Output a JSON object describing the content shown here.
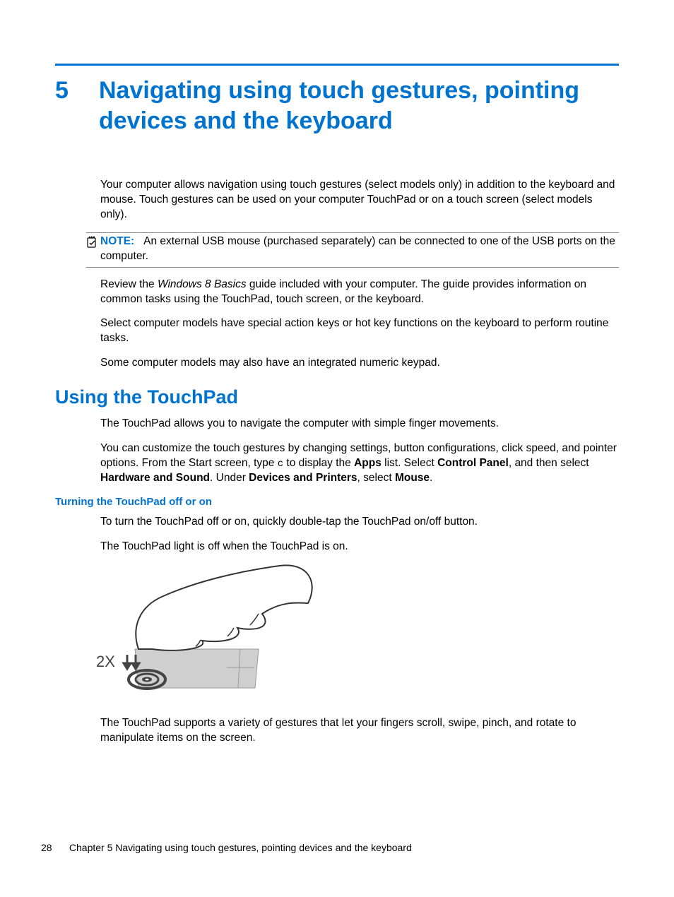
{
  "chapter": {
    "number": "5",
    "title": "Navigating using touch gestures, pointing devices and the keyboard"
  },
  "intro": {
    "p1": "Your computer allows navigation using touch gestures (select models only) in addition to the keyboard and mouse. Touch gestures can be used on your computer TouchPad or on a touch screen (select models only).",
    "note_label": "NOTE:",
    "note_text": "An external USB mouse (purchased separately) can be connected to one of the USB ports on the computer.",
    "p2a": "Review the ",
    "p2_italic": "Windows 8 Basics",
    "p2b": " guide included with your computer. The guide provides information on common tasks using the TouchPad, touch screen, or the keyboard.",
    "p3": "Select computer models have special action keys or hot key functions on the keyboard to perform routine tasks.",
    "p4": "Some computer models may also have an integrated numeric keypad."
  },
  "touchpad": {
    "heading": "Using the TouchPad",
    "p1": "The TouchPad allows you to navigate the computer with simple finger movements.",
    "p2a": "You can customize the touch gestures by changing settings, button configurations, click speed, and pointer options. From the Start screen, type ",
    "p2_mono": "c",
    "p2b": " to display the ",
    "p2_bold1": "Apps",
    "p2c": " list. Select ",
    "p2_bold2": "Control Panel",
    "p2d": ", and then select ",
    "p2_bold3": "Hardware and Sound",
    "p2e": ". Under ",
    "p2_bold4": "Devices and Printers",
    "p2f": ", select ",
    "p2_bold5": "Mouse",
    "p2g": "."
  },
  "turning": {
    "heading": "Turning the TouchPad off or on",
    "p1": "To turn the TouchPad off or on, quickly double-tap the TouchPad on/off button.",
    "p2": "The TouchPad light is off when the TouchPad is on.",
    "image_label": "2X",
    "p3": "The TouchPad supports a variety of gestures that let your fingers scroll, swipe, pinch, and rotate to manipulate items on the screen."
  },
  "footer": {
    "page": "28",
    "text": "Chapter 5   Navigating using touch gestures, pointing devices and the keyboard"
  }
}
